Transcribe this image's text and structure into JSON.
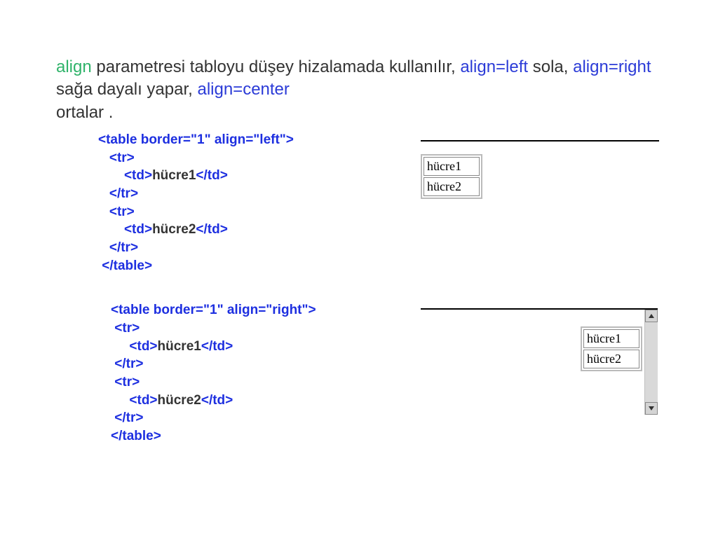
{
  "intro": {
    "kw_align": "align",
    "t1": " parametresi tabloyu düşey hizalamada kullanılır, ",
    "kw_left": "align=left",
    "t2": " sola, ",
    "kw_right": "align=right",
    "t3": " sağa dayalı yapar, ",
    "kw_center": "align=center",
    "t4": " ortalar ."
  },
  "code1": {
    "l1": "<table border=\"1\" align=\"left\">",
    "l2": "<tr>",
    "l3a": "<td>",
    "l3b": "hücre1",
    "l3c": "</td>",
    "l4": "</tr>",
    "l5": "<tr>",
    "l6a": "<td>",
    "l6b": "hücre2",
    "l6c": "</td>",
    "l7": "</tr>",
    "l8": "</table>"
  },
  "code2": {
    "l1": "<table border=\"1\" align=\"right\">",
    "l2": "<tr>",
    "l3a": "<td>",
    "l3b": "hücre1",
    "l3c": "</td>",
    "l4": "</tr>",
    "l5": "<tr>",
    "l6a": "<td>",
    "l6b": "hücre2",
    "l6c": "</td>",
    "l7": "</tr>",
    "l8": "</table>"
  },
  "preview": {
    "cell1": "hücre1",
    "cell2": "hücre2"
  }
}
